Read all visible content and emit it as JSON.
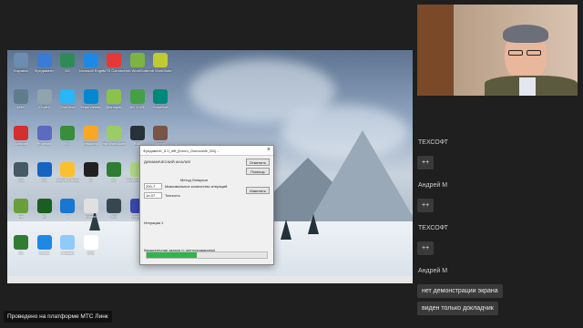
{
  "colors": {
    "page_bg": "#1f1f1f",
    "progress_fill": "#2fb54a",
    "pill_bg": "#3a3a3a"
  },
  "desktop": {
    "icons": [
      {
        "label": "Корзина",
        "icon": "recycle-bin-icon",
        "color": "#6c8cb0"
      },
      {
        "label": "Фундамент",
        "icon": "app-icon",
        "color": "#3a7bd5"
      },
      {
        "label": "5G",
        "icon": "5g-icon",
        "color": "#2e8b57"
      },
      {
        "label": "Microsoft Edge",
        "icon": "edge-icon",
        "color": "#1e88e5"
      },
      {
        "label": "MTS Connect",
        "icon": "mts-icon",
        "color": "#e53935"
      },
      {
        "label": "mb WorkSuite",
        "icon": "mb-icon",
        "color": "#7cb342"
      },
      {
        "label": "mb WorkSuite",
        "icon": "mb-icon",
        "color": "#c0ca33"
      },
      {
        "label": "МФУ",
        "icon": "printer-icon",
        "color": "#607d8b"
      },
      {
        "label": "Отчёт",
        "icon": "doc-icon",
        "color": "#90a4ae"
      },
      {
        "label": "OneDrive",
        "icon": "cloud-icon",
        "color": "#29b6f6"
      },
      {
        "label": "TeamViewer",
        "icon": "tv-icon",
        "color": "#0288d1"
      },
      {
        "label": "Monopoli",
        "icon": "app-icon",
        "color": "#8bc34a"
      },
      {
        "label": "5G 2023",
        "icon": "5g-icon",
        "color": "#43a047"
      },
      {
        "label": "GoodSoft",
        "icon": "app-icon",
        "color": "#00897b"
      },
      {
        "label": "Acrobat",
        "icon": "pdf-icon",
        "color": "#d32f2f"
      },
      {
        "label": "Projektbl",
        "icon": "app-icon",
        "color": "#5c6bc0"
      },
      {
        "label": "5G",
        "icon": "5g-icon",
        "color": "#388e3c"
      },
      {
        "label": "Infokonst",
        "icon": "app-icon",
        "color": "#f9a825"
      },
      {
        "label": "mb WorkSuite",
        "icon": "mb-icon",
        "color": "#9ccc65"
      },
      {
        "label": "BIM",
        "icon": "bim-icon",
        "color": "#263238"
      },
      {
        "label": "Архив",
        "icon": "folder-icon",
        "color": "#795548"
      },
      {
        "label": "Doc",
        "icon": "doc-icon",
        "color": "#455a64"
      },
      {
        "label": "SW",
        "icon": "app-icon",
        "color": "#1565c0"
      },
      {
        "label": "Google Chrome",
        "icon": "chrome-icon",
        "color": "#fbc02d"
      },
      {
        "label": "ИТ",
        "icon": "app-icon",
        "color": "#212121"
      },
      {
        "label": "5G",
        "icon": "5g-icon",
        "color": "#2e7d32"
      },
      {
        "label": "mb WorkSuite",
        "icon": "mb-icon",
        "color": "#aed581"
      },
      {
        "label": "Tools",
        "icon": "app-icon",
        "color": "#8d6e63"
      },
      {
        "label": "mb",
        "icon": "mb-icon",
        "color": "#689f38"
      },
      {
        "label": "5G",
        "icon": "5g-icon",
        "color": "#1b5e20"
      },
      {
        "label": "A",
        "icon": "app-icon",
        "color": "#1976d2"
      },
      {
        "label": "Кодекс",
        "icon": "app-icon",
        "color": "#e0e0e0"
      },
      {
        "label": "BIM",
        "icon": "bim-icon",
        "color": "#37474f"
      },
      {
        "label": "Projektbl",
        "icon": "app-icon",
        "color": "#3949ab"
      },
      {
        "label": "mb",
        "icon": "mb-icon",
        "color": "#7cb342"
      },
      {
        "label": "5G",
        "icon": "5g-icon",
        "color": "#2e7d32"
      },
      {
        "label": "Сервис",
        "icon": "app-icon",
        "color": "#1e88e5"
      },
      {
        "label": "Справка",
        "icon": "app-icon",
        "color": "#90caf9"
      },
      {
        "label": "2000",
        "icon": "app-icon",
        "color": "#ffffff"
      }
    ],
    "dialog": {
      "title": "Фундамент_5.0_diff_[forum_Osnovanie_5fo] ...",
      "close": "×",
      "header": "ДИНАМИЧЕСКИЙ АНАЛИЗ",
      "btn_stop": "Отменить",
      "btn_help": "Помощь",
      "btn_change": "Изменить",
      "method": "Метод Ланцоша",
      "max_iter_label": "Максимальное количество итераций",
      "max_iter_value": "200-7",
      "precision_label": "Точность",
      "precision_value": "1e-07",
      "iteration": "Итерация 1",
      "task": "Квадратичная задача (с центрированием)",
      "progress": 0.42
    }
  },
  "chat": {
    "messages": [
      {
        "name": "ТЕХСОФТ",
        "text": "++"
      },
      {
        "name": "Андрей М",
        "text": "++"
      },
      {
        "name": "ТЕХСОФТ",
        "text": "++"
      },
      {
        "name": "Андрей М",
        "text": "нет демонстрации экрана",
        "text2": "виден только докладчик"
      }
    ]
  },
  "footer": "Проведено на платформе МТС Линк"
}
